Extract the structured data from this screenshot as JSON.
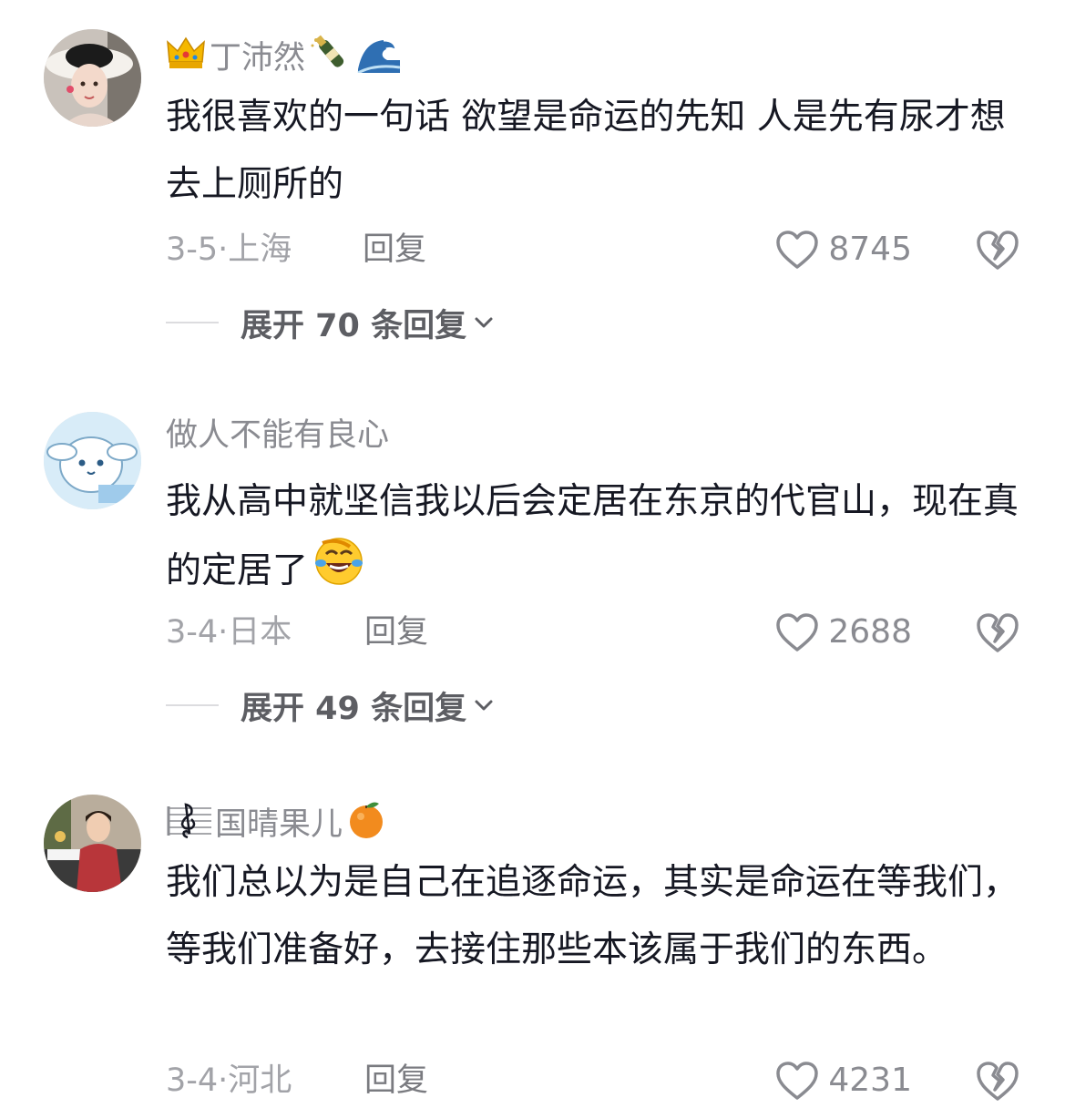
{
  "comments": [
    {
      "username": "丁沛然",
      "text": "我很喜欢的一句话 欲望是命运的先知 人是先有尿才想去上厕所的",
      "date": "3-5·",
      "location": "上海",
      "reply_label": "回复",
      "likes": "8745",
      "expand_label": "展开 70 条回复",
      "icons": [
        "crown-emoji",
        "champagne-emoji",
        "wave-emoji"
      ]
    },
    {
      "username": "做人不能有良心",
      "text": "我从高中就坚信我以后会定居在东京的代官山，现在真的定居了",
      "date": "3-4·",
      "location": "日本",
      "reply_label": "回复",
      "likes": "2688",
      "expand_label": "展开 49 条回复",
      "icons": [
        "laughing-crying-emoji"
      ]
    },
    {
      "username": "国晴果儿",
      "text": "我们总以为是自己在追逐命运，其实是命运在等我们，等我们准备好，去接住那些本该属于我们的东西。",
      "date": "3-4·",
      "location": "河北",
      "reply_label": "回复",
      "likes": "4231",
      "icons": [
        "music-staff-icon",
        "orange-emoji"
      ]
    }
  ],
  "colors": {
    "text": "#161823",
    "meta": "#a2a3a8",
    "username": "#8a8b91",
    "accent_crown": "#f5b800"
  }
}
